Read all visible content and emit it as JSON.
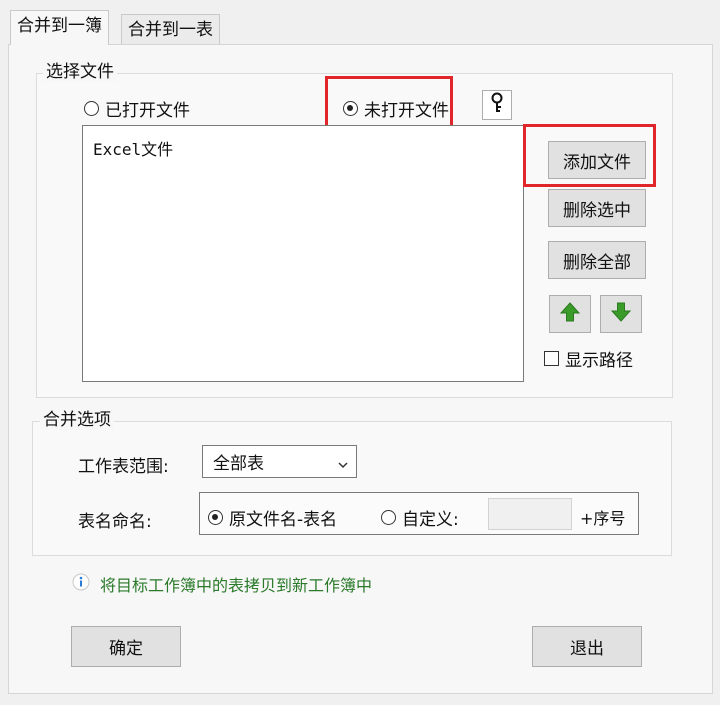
{
  "tabs": [
    {
      "label": "合并到一簿",
      "active": true
    },
    {
      "label": "合并到一表",
      "active": false
    }
  ],
  "select_files": {
    "legend": "选择文件",
    "radio_opened": "已打开文件",
    "radio_unopened": "未打开文件",
    "selected": "radio_unopened",
    "key_icon": "key-icon",
    "list_header": "Excel文件",
    "add_button": "添加文件",
    "delete_selected_button": "删除选中",
    "delete_all_button": "删除全部",
    "move_up_icon": "arrow-up-icon",
    "move_down_icon": "arrow-down-icon",
    "show_path_label": "显示路径",
    "show_path_checked": false
  },
  "merge_options": {
    "legend": "合并选项",
    "sheet_range_label": "工作表范围:",
    "sheet_range_value": "全部表",
    "naming_label": "表名命名:",
    "naming_original": "原文件名-表名",
    "naming_custom": "自定义:",
    "naming_selected": "naming_original",
    "custom_value": "",
    "seq_label": "+序号"
  },
  "info": {
    "icon": "info-icon",
    "text": "将目标工作簿中的表拷贝到新工作簿中"
  },
  "footer": {
    "ok_button": "确定",
    "exit_button": "退出"
  },
  "colors": {
    "highlight": "#e0262a",
    "arrow_green": "#3a9a2a",
    "info_blue": "#2b7bd6"
  }
}
